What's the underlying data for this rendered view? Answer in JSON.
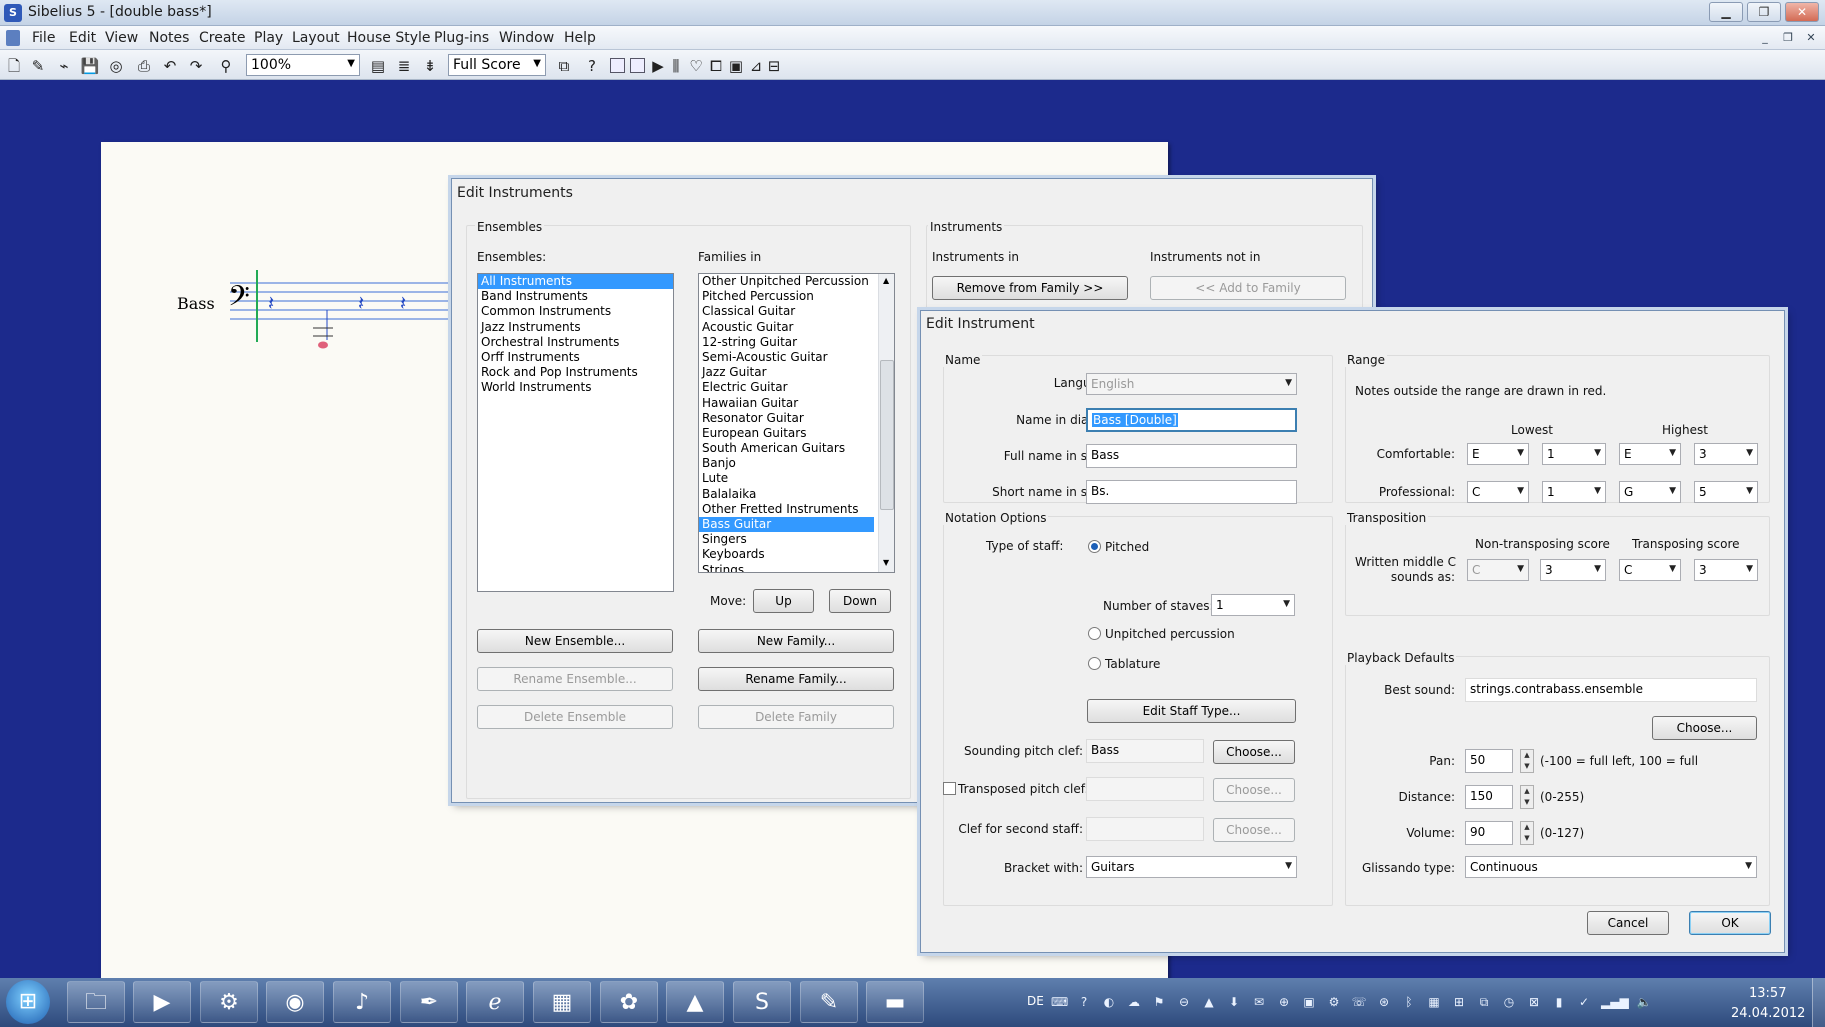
{
  "window": {
    "title": "Sibelius 5 - [double bass*]",
    "app_icon": "S"
  },
  "menu": [
    "File",
    "Edit",
    "View",
    "Notes",
    "Create",
    "Play",
    "Layout",
    "House Style",
    "Plug-ins",
    "Window",
    "Help"
  ],
  "toolbar": {
    "zoom": "100%",
    "score_view": "Full Score"
  },
  "score": {
    "staff_label": "Bass"
  },
  "edit_instruments": {
    "title": "Edit Instruments",
    "ensembles_group": "Ensembles",
    "ensembles_label": "Ensembles:",
    "ensembles": [
      "All Instruments",
      "Band Instruments",
      "Common Instruments",
      "Jazz Instruments",
      "Orchestral Instruments",
      "Orff Instruments",
      "Rock and Pop Instruments",
      "World Instruments"
    ],
    "families_label": "Families in",
    "families": [
      "Other Unpitched Percussion",
      "Pitched Percussion",
      "Classical Guitar",
      "Acoustic Guitar",
      "12-string Guitar",
      "Semi-Acoustic Guitar",
      "Jazz Guitar",
      "Electric Guitar",
      "Hawaiian Guitar",
      "Resonator Guitar",
      "European Guitars",
      "South American Guitars",
      "Banjo",
      "Lute",
      "Balalaika",
      "Other Fretted Instruments",
      "Bass Guitar",
      "Singers",
      "Keyboards",
      "Strings"
    ],
    "move_label": "Move:",
    "up": "Up",
    "down": "Down",
    "new_ensemble": "New Ensemble...",
    "rename_ensemble": "Rename Ensemble...",
    "delete_ensemble": "Delete Ensemble",
    "new_family": "New Family...",
    "rename_family": "Rename Family...",
    "delete_family": "Delete Family",
    "instruments_group": "Instruments",
    "instruments_in": "Instruments in",
    "instruments_not_in": "Instruments not in",
    "remove_from_family": "Remove from Family >>",
    "add_to_family": "<< Add to Family"
  },
  "edit_instrument": {
    "title": "Edit Instrument",
    "name_group": "Name",
    "language_label": "Language:",
    "language": "English",
    "name_in_dialogs_label": "Name in dialogs:",
    "name_in_dialogs": "Bass [Double]",
    "full_name_label": "Full name in score:",
    "full_name": "Bass",
    "short_name_label": "Short name in score:",
    "short_name": "Bs.",
    "notation_group": "Notation Options",
    "type_of_staff_label": "Type of staff:",
    "pitched": "Pitched",
    "number_of_staves_label": "Number of staves:",
    "number_of_staves": "1",
    "unpitched": "Unpitched percussion",
    "tablature": "Tablature",
    "edit_staff_type": "Edit Staff Type...",
    "sounding_clef_label": "Sounding pitch clef:",
    "sounding_clef": "Bass",
    "choose": "Choose...",
    "transposed_clef_label": "Transposed pitch clef:",
    "second_staff_clef_label": "Clef for second staff:",
    "bracket_label": "Bracket with:",
    "bracket": "Guitars",
    "range_group": "Range",
    "range_note": "Notes outside the range are drawn in red.",
    "lowest": "Lowest",
    "highest": "Highest",
    "comfortable_label": "Comfortable:",
    "comfortable": [
      "E",
      "1",
      "E",
      "3"
    ],
    "professional_label": "Professional:",
    "professional": [
      "C",
      "1",
      "G",
      "5"
    ],
    "transposition_group": "Transposition",
    "non_transposing": "Non-transposing score",
    "transposing": "Transposing score",
    "written_c_label_1": "Written middle C",
    "written_c_label_2": "sounds as:",
    "written_c": [
      "C",
      "3",
      "C",
      "3"
    ],
    "playback_group": "Playback Defaults",
    "best_sound_label": "Best sound:",
    "best_sound": "strings.contrabass.ensemble",
    "pan_label": "Pan:",
    "pan": "50",
    "pan_hint": "(-100 = full left, 100 = full",
    "distance_label": "Distance:",
    "distance": "150",
    "distance_hint": "(0-255)",
    "volume_label": "Volume:",
    "volume": "90",
    "volume_hint": "(0-127)",
    "glissando_label": "Glissando type:",
    "glissando": "Continuous",
    "cancel": "Cancel",
    "ok": "OK"
  },
  "taskbar": {
    "lang": "DE",
    "time": "13:57",
    "date": "24.04.2012"
  },
  "colors": {
    "desktop": "#1c2a8c",
    "selection": "#3399ff",
    "staff_line": "#3b6fd8"
  }
}
